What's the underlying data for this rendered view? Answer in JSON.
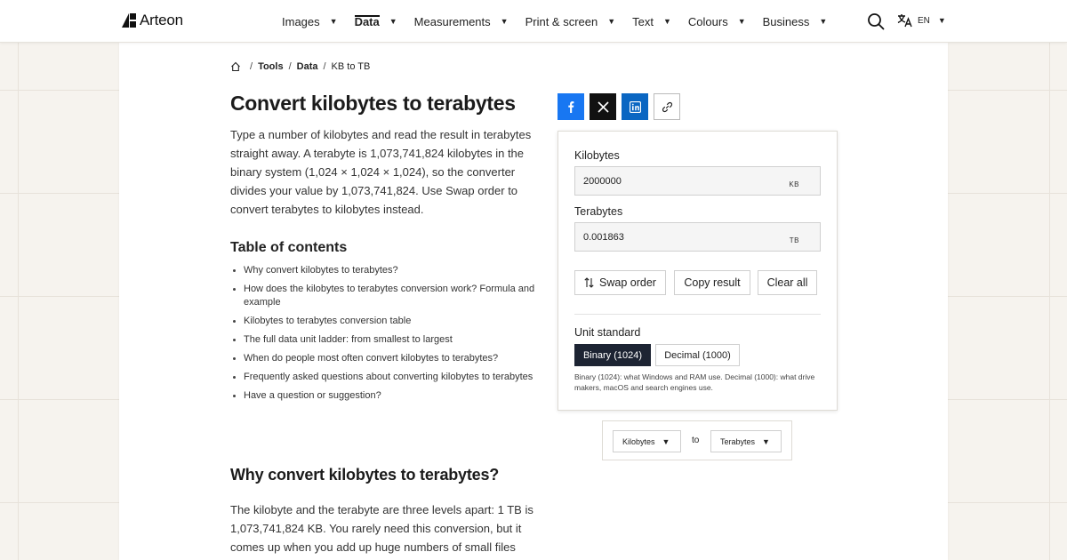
{
  "brand": {
    "name": "Arteon"
  },
  "nav": {
    "items": [
      {
        "label": "Images",
        "active": false
      },
      {
        "label": "Data",
        "active": true
      },
      {
        "label": "Measurements",
        "active": false
      },
      {
        "label": "Print & screen",
        "active": false
      },
      {
        "label": "Text",
        "active": false
      },
      {
        "label": "Colours",
        "active": false
      },
      {
        "label": "Business",
        "active": false
      }
    ],
    "language": "EN"
  },
  "breadcrumb": [
    "Tools",
    "Data",
    "KB to TB"
  ],
  "page": {
    "title": "Convert kilobytes to terabytes",
    "intro": "Type a number of kilobytes and read the result in terabytes straight away. A terabyte is 1,073,741,824 kilobytes in the binary system (1,024 × 1,024 × 1,024), so the converter divides your value by 1,073,741,824. Use Swap order to convert terabytes to kilobytes instead.",
    "toc_title": "Table of contents",
    "toc": [
      "Why convert kilobytes to terabytes?",
      "How does the kilobytes to terabytes conversion work? Formula and example",
      "Kilobytes to terabytes conversion table",
      "The full data unit ladder: from smallest to largest",
      "When do people most often convert kilobytes to terabytes?",
      "Frequently asked questions about converting kilobytes to terabytes",
      "Have a question or suggestion?"
    ],
    "section_title": "Why convert kilobytes to terabytes?",
    "section_text": "The kilobyte and the terabyte are three levels apart: 1 TB is 1,073,741,824 KB. You rarely need this conversion, but it comes up when you add up huge numbers of small files"
  },
  "share": [
    "facebook-icon",
    "x-icon",
    "linkedin-icon",
    "link-icon"
  ],
  "converter": {
    "from_label": "Kilobytes",
    "from_value": "2000000",
    "from_unit": "KB",
    "to_label": "Terabytes",
    "to_value": "0.001863",
    "to_unit": "TB",
    "swap_label": "Swap order",
    "copy_label": "Copy result",
    "clear_label": "Clear all",
    "standard_label": "Unit standard",
    "binary_label": "Binary (1024)",
    "decimal_label": "Decimal (1000)",
    "selected_standard": "binary",
    "note": "Binary (1024): what Windows and RAM use. Decimal (1000): what drive makers, macOS and search engines use."
  },
  "unit_select": {
    "from": "Kilobytes",
    "connector": "to",
    "to": "Terabytes"
  },
  "colors": {
    "accent_dark": "#1d2433",
    "facebook": "#1877f2",
    "linkedin": "#0a66c2",
    "x": "#111111"
  }
}
